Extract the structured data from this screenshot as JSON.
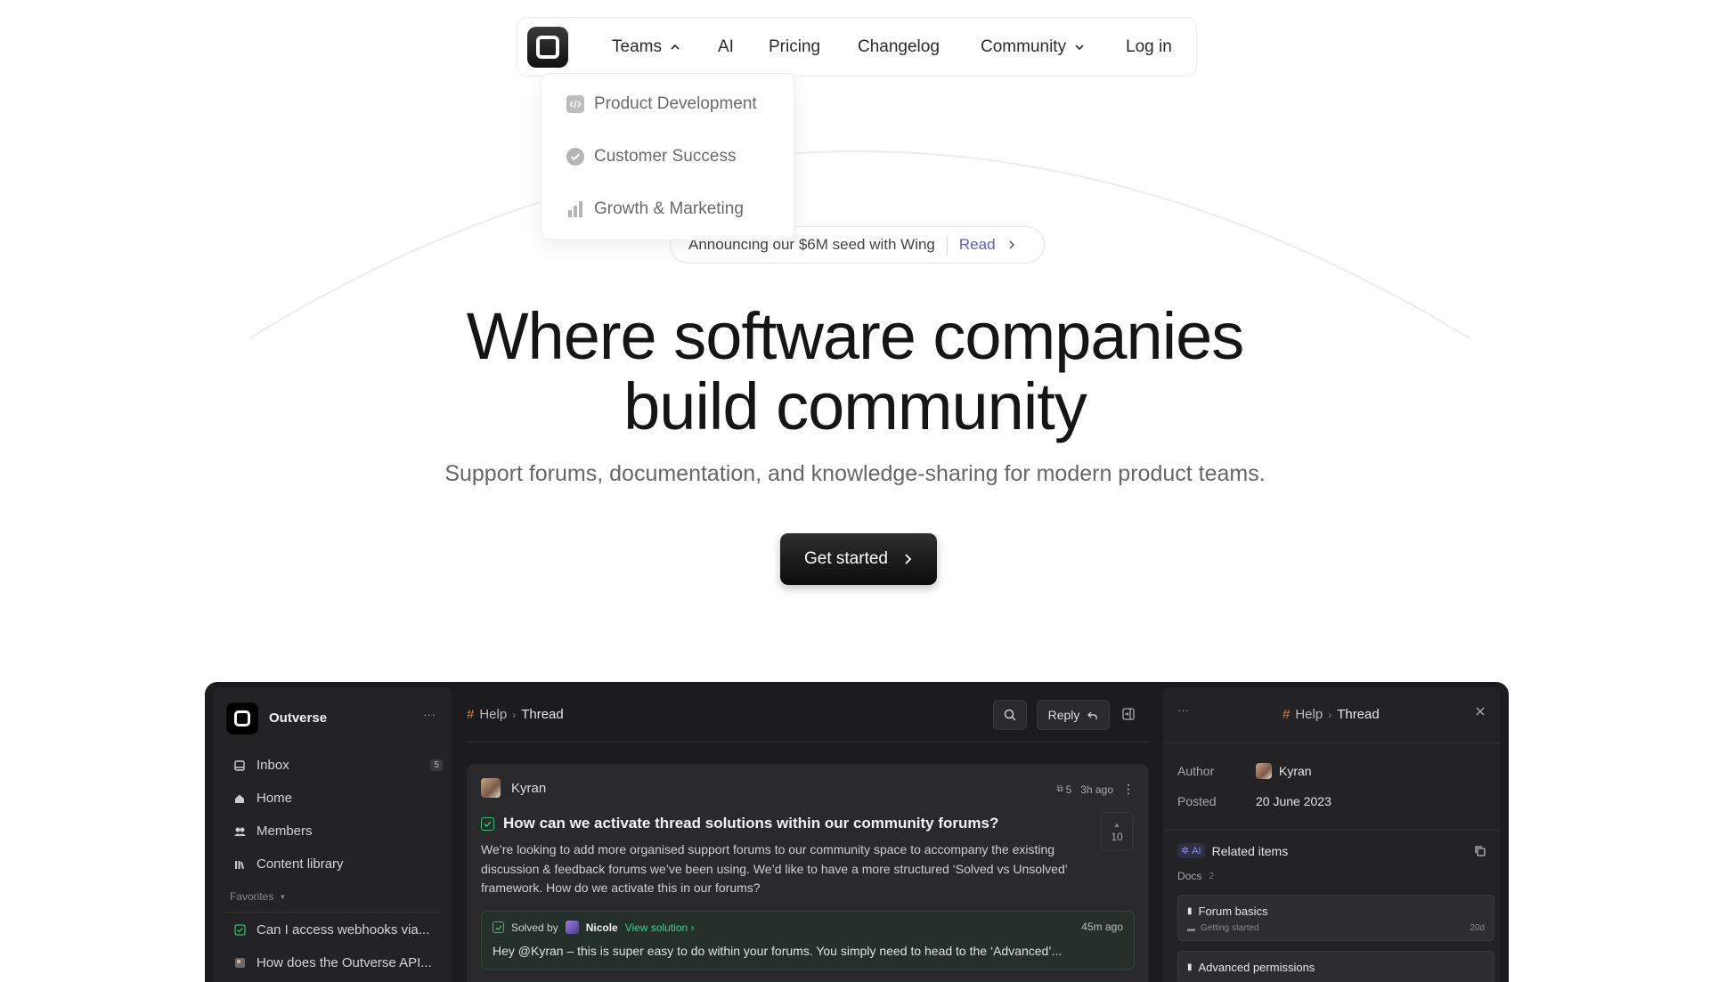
{
  "nav": {
    "items": [
      "Teams",
      "AI",
      "Pricing",
      "Changelog",
      "Community",
      "Log in"
    ]
  },
  "dropdown": {
    "items": [
      "Product Development",
      "Customer Success",
      "Growth & Marketing"
    ]
  },
  "announcement": {
    "text": "Announcing our $6M seed with Wing",
    "link": "Read"
  },
  "hero": {
    "title_line1": "Where software companies",
    "title_line2": "build community",
    "subtitle": "Support forums, documentation, and knowledge-sharing for modern product teams.",
    "cta": "Get started"
  },
  "app": {
    "workspace": "Outverse",
    "sidebar": {
      "items": [
        {
          "label": "Inbox",
          "icon": "inbox-icon",
          "badge": "5"
        },
        {
          "label": "Home",
          "icon": "home-icon"
        },
        {
          "label": "Members",
          "icon": "members-icon"
        },
        {
          "label": "Content library",
          "icon": "library-icon"
        }
      ],
      "favorites_label": "Favorites",
      "favorites": [
        "Can I access webhooks via...",
        "How does the Outverse API..."
      ]
    },
    "breadcrumb": {
      "hash": "#",
      "section": "Help",
      "page": "Thread"
    },
    "reply_label": "Reply",
    "thread": {
      "author": "Kyran",
      "replies": "5",
      "time": "3h ago",
      "title": "How can we activate thread solutions within our community forums?",
      "body": "We’re looking to add more organised support forums to our community space to accompany the existing discussion & feedback forums we’ve been using. We’d like to have a more structured ‘Solved vs Unsolved’ framework. How do we activate this in our forums?",
      "votes": "10",
      "solution": {
        "solved_by": "Solved by",
        "solver": "Nicole",
        "view": "View solution",
        "time": "45m ago",
        "text": "Hey @Kyran – this is super easy to do within your forums. You simply need to head to the ‘Advanced’..."
      }
    },
    "panel": {
      "dots": "···",
      "breadcrumb": {
        "hash": "#",
        "section": "Help",
        "page": "Thread"
      },
      "author_label": "Author",
      "author": "Kyran",
      "posted_label": "Posted",
      "posted": "20 June 2023",
      "ai_label": "AI",
      "related_label": "Related items",
      "docs_label": "Docs",
      "docs_count": "2",
      "docs": [
        {
          "title": "Forum basics",
          "folder": "Getting started",
          "age": "20d"
        },
        {
          "title": "Advanced permissions",
          "folder": "",
          "age": ""
        }
      ]
    }
  },
  "colors": {
    "accent": "#5b5bd6",
    "solved": "#3ecf8e",
    "hash": "#e2813a",
    "dark": "#1c1c1e"
  }
}
